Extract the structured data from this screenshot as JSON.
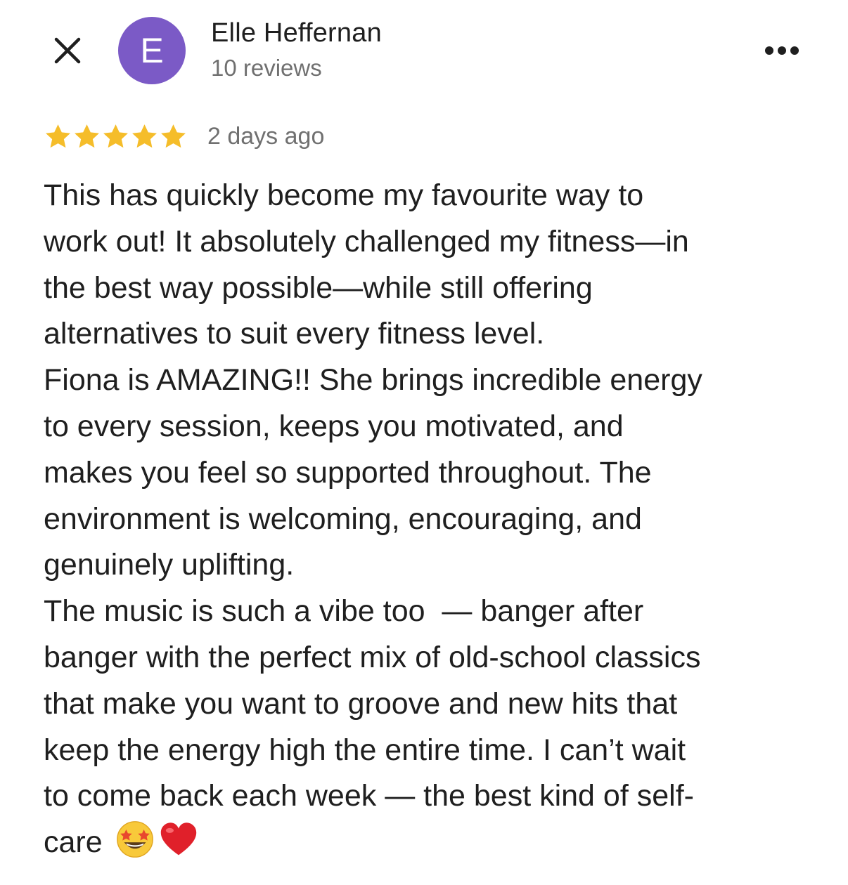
{
  "header": {
    "close_icon": "close-icon",
    "avatar_letter": "E",
    "avatar_color": "#7b5ac6",
    "name": "Elle Heffernan",
    "reviews_count": "10 reviews",
    "more_icon": "more-horizontal-icon"
  },
  "review": {
    "rating": 5,
    "rating_max": 5,
    "star_color": "#f5bd2a",
    "date": "2 days ago",
    "lines": [
      "This has quickly become my favourite way to",
      "work out! It absolutely challenged my fitness—in",
      "the best way possible—while still offering",
      "alternatives to suit every fitness level.",
      "Fiona is AMAZING!! She brings incredible energy",
      "to every session, keeps you motivated, and",
      "makes you feel so supported throughout. The",
      "environment is welcoming, encouraging, and",
      "genuinely uplifting.",
      "The music is such a vibe too  — banger after",
      "banger with the perfect mix of old-school classics",
      "that make you want to groove and new hits that",
      "keep the energy high the entire time. I can’t wait",
      "to come back each week — the best kind of self-",
      "care"
    ],
    "emojis": [
      "star-struck-emoji",
      "red-heart-emoji"
    ]
  }
}
